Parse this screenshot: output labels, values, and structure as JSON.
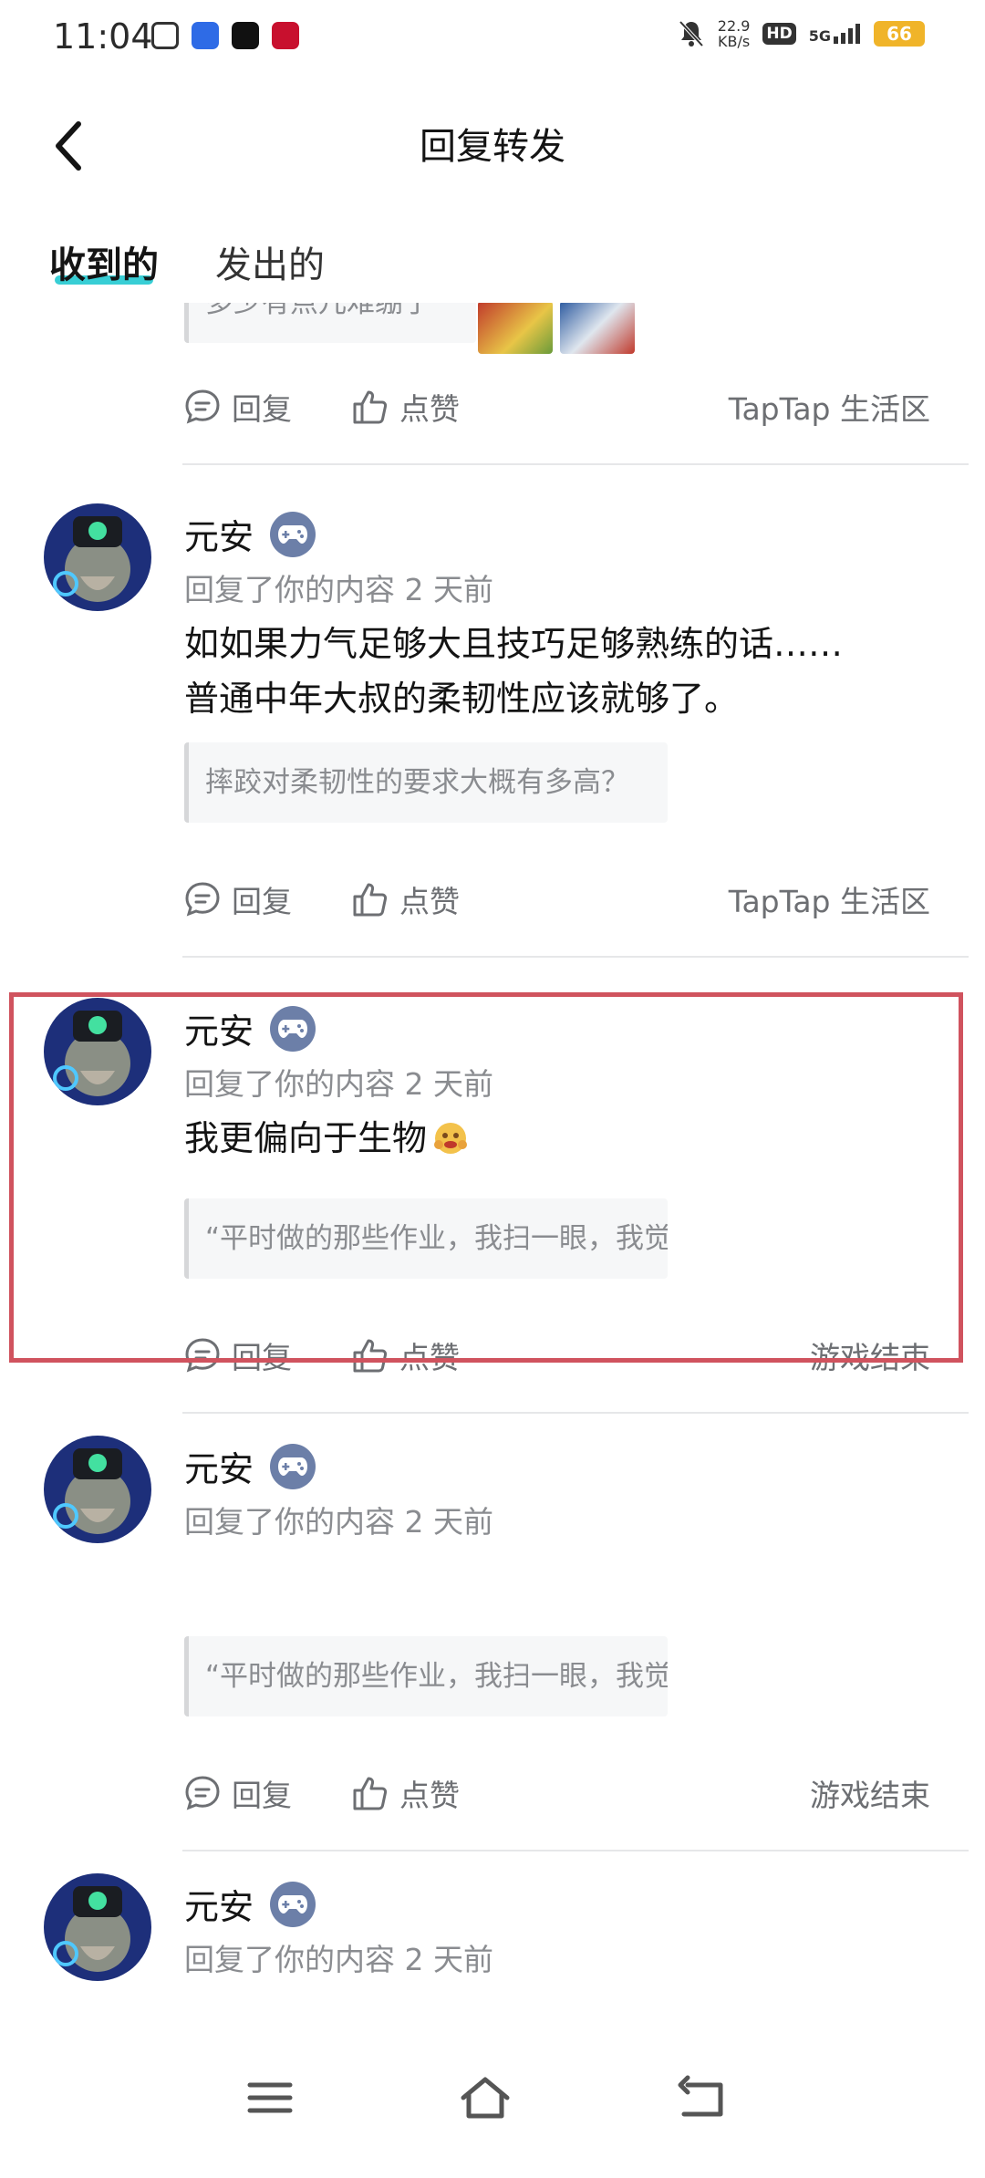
{
  "status_bar": {
    "time": "11:04",
    "speed_value": "22.9",
    "speed_unit": "KB/s",
    "hd": "HD",
    "network": "5G",
    "battery": "66"
  },
  "nav": {
    "title": "回复转发"
  },
  "tabs": [
    {
      "label": "收到的"
    },
    {
      "label": "发出的"
    }
  ],
  "items": [
    {
      "quote": "多少有点儿难绷了",
      "actions": {
        "reply": "回复",
        "like": "点赞",
        "source": "TapTap 生活区"
      }
    },
    {
      "username": "元安",
      "meta": "回复了你的内容 2 天前",
      "content_lines": [
        "如如果力气足够大且技巧足够熟练的话……",
        "普通中年大叔的柔韧性应该就够了。"
      ],
      "quote": "摔跤对柔韧性的要求大概有多高？",
      "actions": {
        "reply": "回复",
        "like": "点赞",
        "source": "TapTap 生活区"
      }
    },
    {
      "username": "元安",
      "meta": "回复了你的内容 2 天前",
      "content": "我更偏向于生物",
      "quote": "“平时做的那些作业，我扫一眼，我觉得没有…",
      "actions": {
        "reply": "回复",
        "like": "点赞",
        "source": "游戏结束"
      }
    },
    {
      "username": "元安",
      "meta": "回复了你的内容 2 天前",
      "quote": "“平时做的那些作业，我扫一眼，我觉得没有…",
      "actions": {
        "reply": "回复",
        "like": "点赞",
        "source": "游戏结束"
      }
    },
    {
      "username": "元安",
      "meta": "回复了你的内容 2 天前"
    }
  ],
  "colors": {
    "accent": "#15c5ce",
    "highlight_border": "#d0535e",
    "badge": "#6c7fa8",
    "battery": "#f0b429"
  },
  "icons": {
    "back": "chevron-left-icon",
    "reply": "comment-bubble-icon",
    "like": "thumbs-up-icon",
    "badge": "gamepad-icon",
    "nav_menu": "menu-icon",
    "nav_home": "home-icon",
    "nav_back": "back-gesture-icon"
  }
}
